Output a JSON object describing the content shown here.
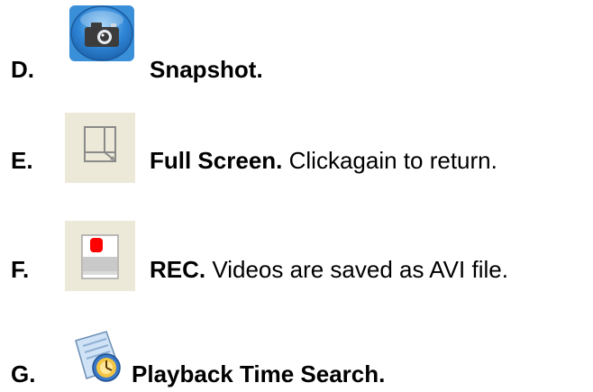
{
  "items": [
    {
      "letter": "D.",
      "title": "Snapshot.",
      "description": "",
      "icon": "camera-icon"
    },
    {
      "letter": "E.",
      "title": "Full Screen.",
      "description": "Clickagain to return.",
      "icon": "full-screen-icon"
    },
    {
      "letter": "F.",
      "title": "REC.",
      "description": "Videos are saved as AVI file.",
      "icon": "record-icon"
    },
    {
      "letter": "G.",
      "title": "Playback Time Search.",
      "description": "",
      "icon": "playback-time-search-icon"
    }
  ],
  "colors": {
    "camera_blue": "#2f86d6",
    "record_red": "#ff0000",
    "icon_bg": "#ece9d8"
  }
}
